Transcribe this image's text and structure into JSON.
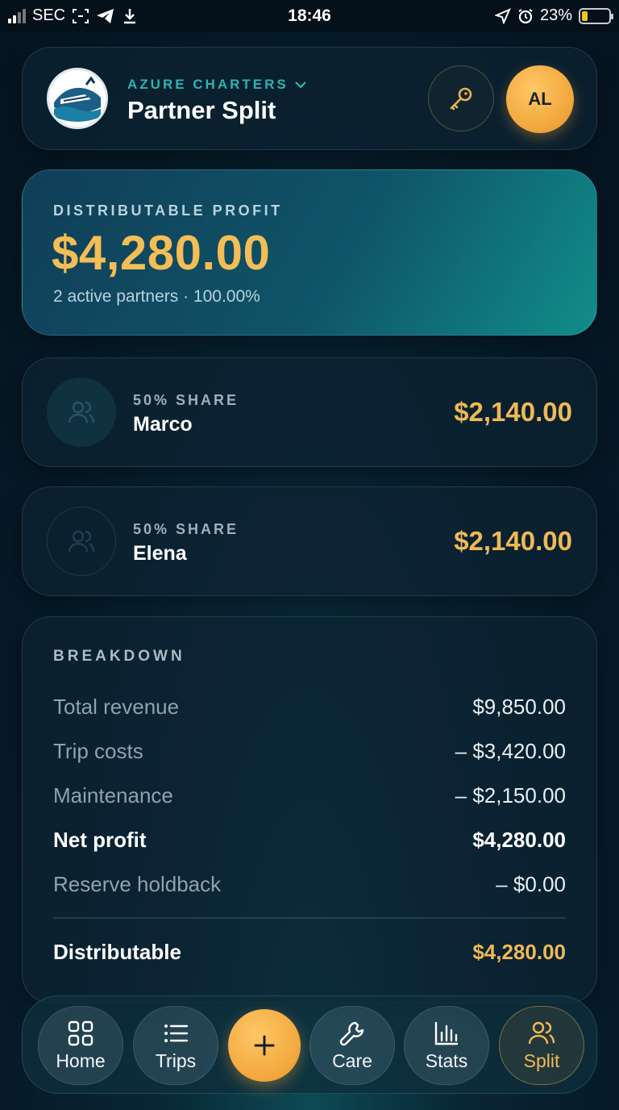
{
  "status_bar": {
    "carrier": "SEC",
    "time": "18:46",
    "battery_percent": "23%",
    "battery_level": 0.23
  },
  "header": {
    "brand": "AZURE CHARTERS",
    "title": "Partner Split",
    "avatar_initials": "AL",
    "icons": [
      "logo-icon",
      "chevron-down-icon",
      "key-icon"
    ]
  },
  "summary": {
    "label": "DISTRIBUTABLE PROFIT",
    "amount": "$4,280.00",
    "subtitle": "2 active partners · 100.00%"
  },
  "partners": [
    {
      "share": "50% SHARE",
      "name": "Marco",
      "amount": "$2,140.00",
      "icon": "users-icon"
    },
    {
      "share": "50% SHARE",
      "name": "Elena",
      "amount": "$2,140.00",
      "icon": "users-icon"
    }
  ],
  "breakdown": {
    "title": "BREAKDOWN",
    "rows": [
      {
        "label": "Total revenue",
        "value": "$9,850.00"
      },
      {
        "label": "Trip costs",
        "value": "– $3,420.00"
      },
      {
        "label": "Maintenance",
        "value": "– $2,150.00"
      },
      {
        "label": "Net profit",
        "value": "$4,280.00"
      },
      {
        "label": "Reserve holdback",
        "value": "– $0.00"
      }
    ],
    "total": {
      "label": "Distributable",
      "value": "$4,280.00"
    }
  },
  "nav": {
    "items": [
      {
        "label": "Home",
        "icon": "grid-icon"
      },
      {
        "label": "Trips",
        "icon": "list-icon"
      },
      {
        "label": "Care",
        "icon": "wrench-icon"
      },
      {
        "label": "Stats",
        "icon": "bar-chart-icon"
      },
      {
        "label": "Split",
        "icon": "users-icon"
      }
    ],
    "add_icon": "plus-icon",
    "active": "Split"
  },
  "colors": {
    "accent_gold": "#f0b955",
    "accent_teal": "#2bb3b0",
    "background": "#061a28"
  }
}
